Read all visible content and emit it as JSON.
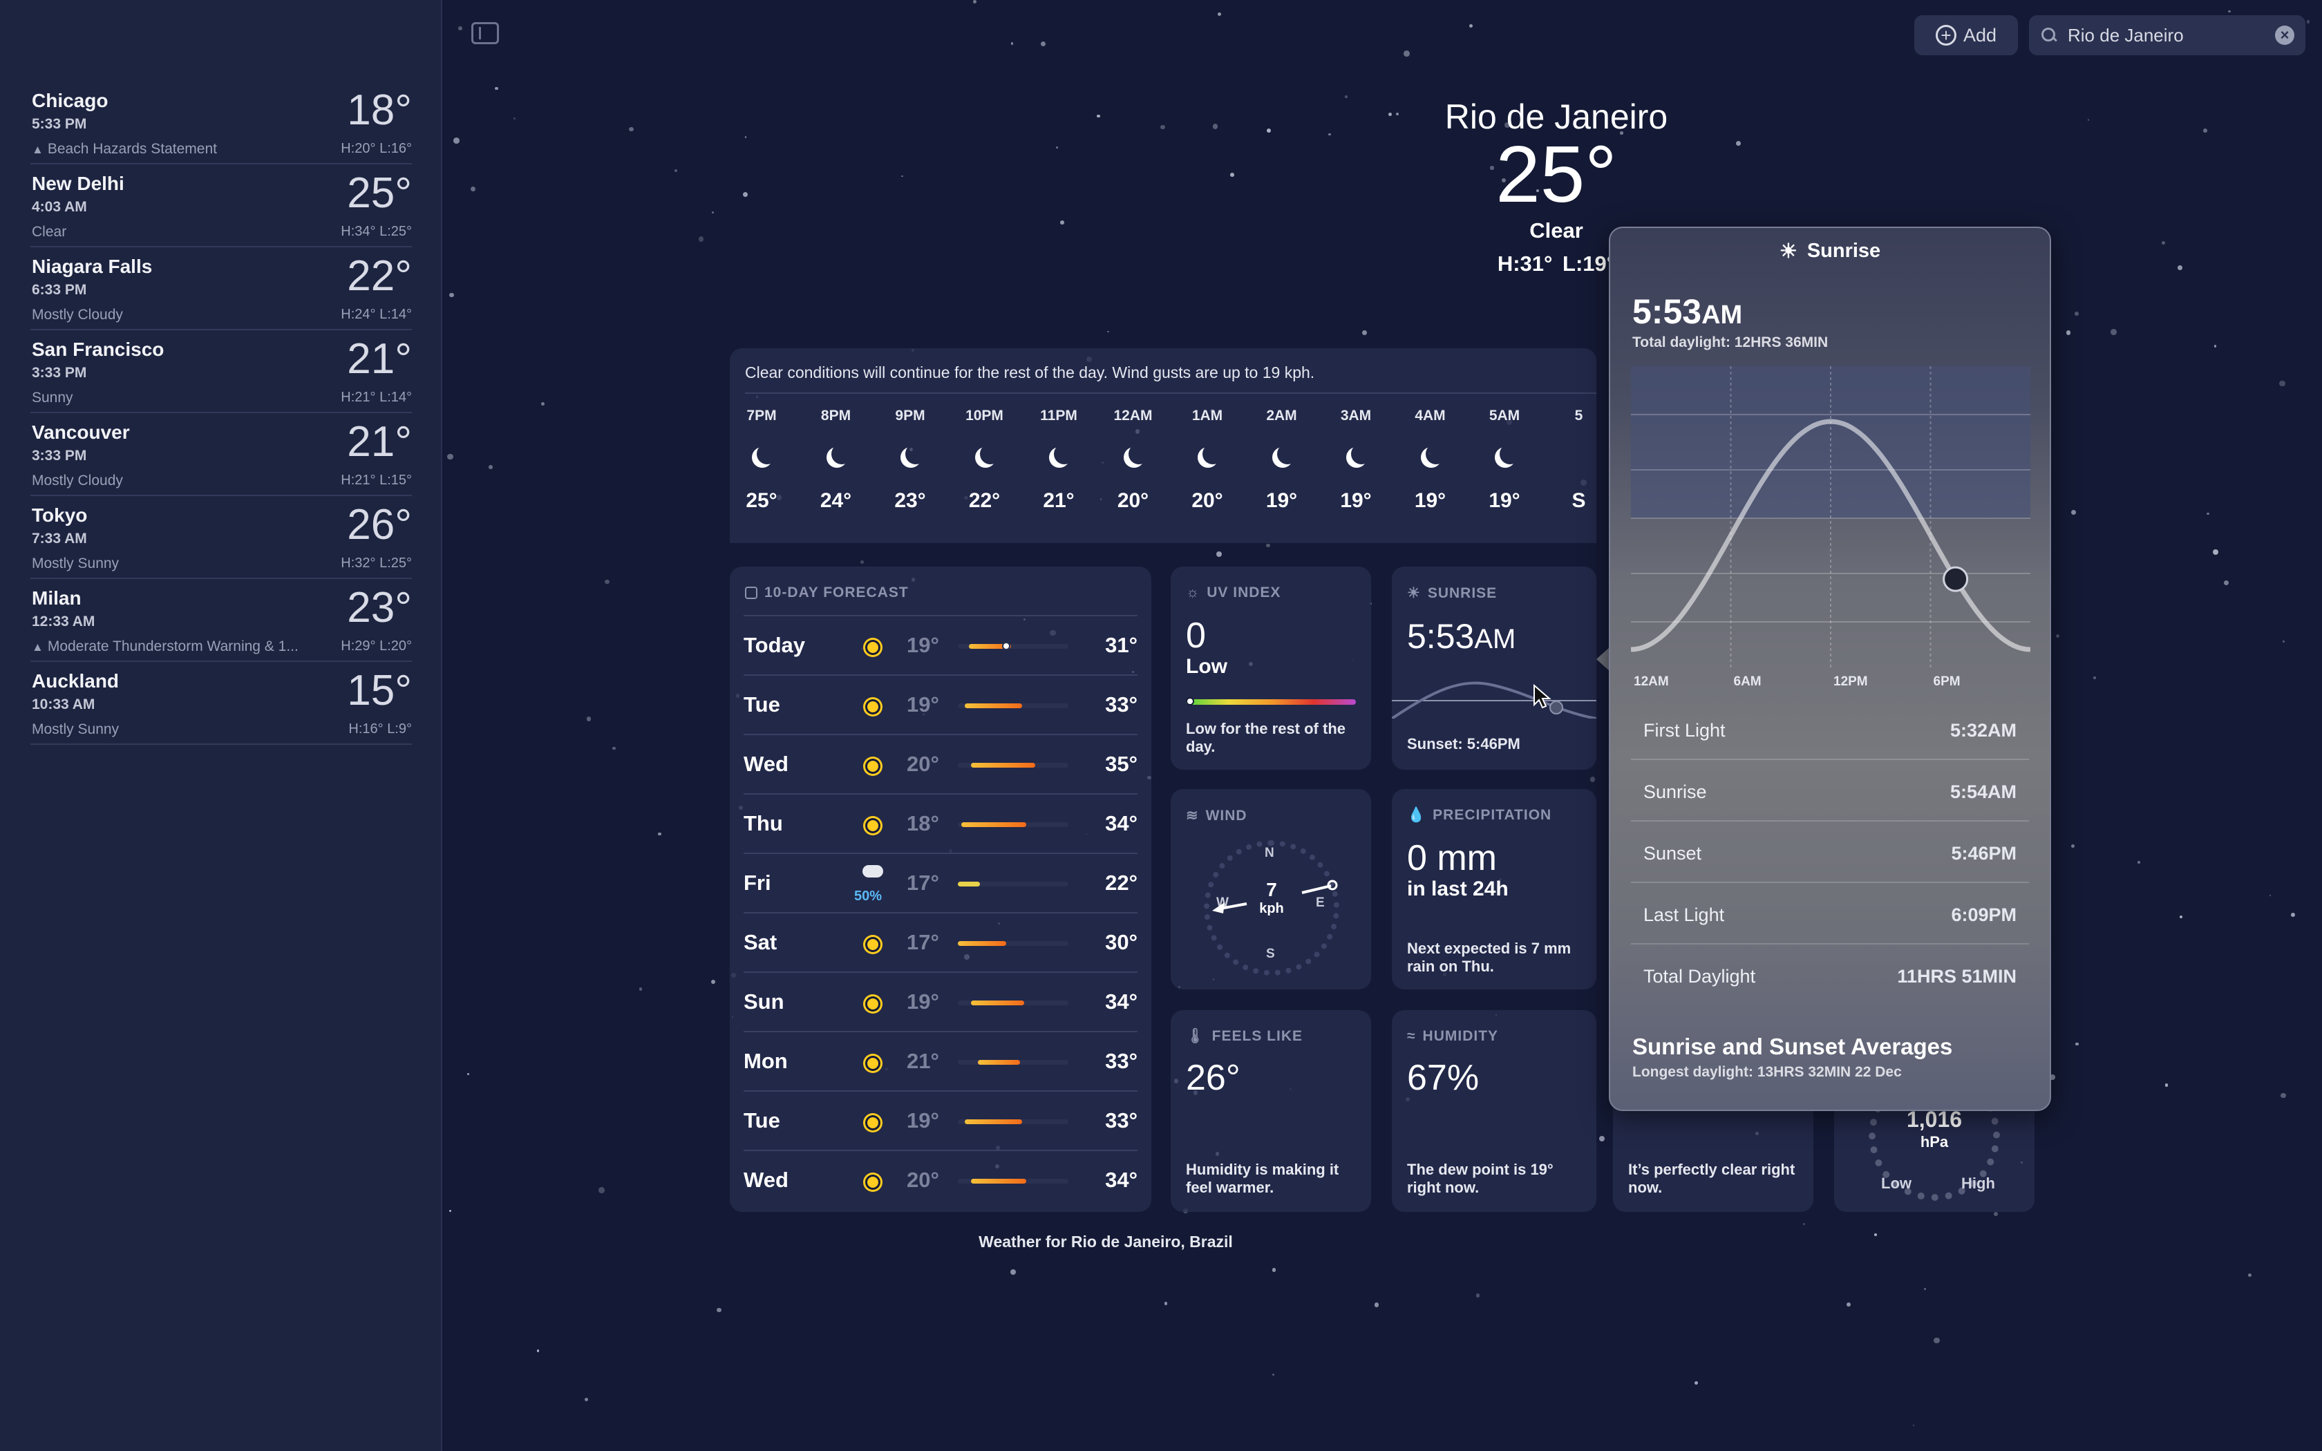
{
  "sidebar": {
    "cities": [
      {
        "name": "Chicago",
        "time": "5:33 PM",
        "condition": "Beach Hazards Statement",
        "warning": true,
        "temp": "18°",
        "hl": "H:20°  L:16°"
      },
      {
        "name": "New Delhi",
        "time": "4:03 AM",
        "condition": "Clear",
        "warning": false,
        "temp": "25°",
        "hl": "H:34°  L:25°"
      },
      {
        "name": "Niagara Falls",
        "time": "6:33 PM",
        "condition": "Mostly Cloudy",
        "warning": false,
        "temp": "22°",
        "hl": "H:24°  L:14°"
      },
      {
        "name": "San Francisco",
        "time": "3:33 PM",
        "condition": "Sunny",
        "warning": false,
        "temp": "21°",
        "hl": "H:21°  L:14°"
      },
      {
        "name": "Vancouver",
        "time": "3:33 PM",
        "condition": "Mostly Cloudy",
        "warning": false,
        "temp": "21°",
        "hl": "H:21°  L:15°"
      },
      {
        "name": "Tokyo",
        "time": "7:33 AM",
        "condition": "Mostly Sunny",
        "warning": false,
        "temp": "26°",
        "hl": "H:32°  L:25°"
      },
      {
        "name": "Milan",
        "time": "12:33 AM",
        "condition": "Moderate Thunderstorm Warning & 1...",
        "warning": true,
        "temp": "23°",
        "hl": "H:29°  L:20°"
      },
      {
        "name": "Auckland",
        "time": "10:33 AM",
        "condition": "Mostly Sunny",
        "warning": false,
        "temp": "15°",
        "hl": "H:16°  L:9°"
      }
    ]
  },
  "toolbar": {
    "add_label": "Add",
    "search_value": "Rio de Janeiro"
  },
  "hero": {
    "city": "Rio de Janeiro",
    "temp": "25°",
    "condition": "Clear",
    "hl": "H:31°  L:19°"
  },
  "hourly": {
    "summary": "Clear conditions will continue for the rest of the day. Wind gusts are up to 19 kph.",
    "hours": [
      {
        "label": "7PM",
        "temp": "25°"
      },
      {
        "label": "8PM",
        "temp": "24°"
      },
      {
        "label": "9PM",
        "temp": "23°"
      },
      {
        "label": "10PM",
        "temp": "22°"
      },
      {
        "label": "11PM",
        "temp": "21°"
      },
      {
        "label": "12AM",
        "temp": "20°"
      },
      {
        "label": "1AM",
        "temp": "20°"
      },
      {
        "label": "2AM",
        "temp": "19°"
      },
      {
        "label": "3AM",
        "temp": "19°"
      },
      {
        "label": "4AM",
        "temp": "19°"
      },
      {
        "label": "5AM",
        "temp": "19°"
      },
      {
        "label": "5",
        "temp": "S"
      }
    ]
  },
  "tenday": {
    "title": "10-DAY FORECAST",
    "days": [
      {
        "name": "Today",
        "low": "19°",
        "high": "31°",
        "icon": "sun-icon",
        "bar_start": 0.1,
        "bar_end": 0.48,
        "current": 0.4
      },
      {
        "name": "Tue",
        "low": "19°",
        "high": "33°",
        "icon": "sun-icon",
        "bar_start": 0.06,
        "bar_end": 0.58
      },
      {
        "name": "Wed",
        "low": "20°",
        "high": "35°",
        "icon": "sun-icon",
        "bar_start": 0.12,
        "bar_end": 0.7
      },
      {
        "name": "Thu",
        "low": "18°",
        "high": "34°",
        "icon": "sun-icon",
        "bar_start": 0.03,
        "bar_end": 0.62
      },
      {
        "name": "Fri",
        "low": "17°",
        "high": "22°",
        "icon": "rain-cloud-icon",
        "rain": "50%",
        "bar_start": 0.0,
        "bar_end": 0.2
      },
      {
        "name": "Sat",
        "low": "17°",
        "high": "30°",
        "icon": "sun-icon",
        "bar_start": 0.0,
        "bar_end": 0.44
      },
      {
        "name": "Sun",
        "low": "19°",
        "high": "34°",
        "icon": "sun-icon",
        "bar_start": 0.12,
        "bar_end": 0.6
      },
      {
        "name": "Mon",
        "low": "21°",
        "high": "33°",
        "icon": "sun-icon",
        "bar_start": 0.18,
        "bar_end": 0.56
      },
      {
        "name": "Tue",
        "low": "19°",
        "high": "33°",
        "icon": "sun-icon",
        "bar_start": 0.06,
        "bar_end": 0.58
      },
      {
        "name": "Wed",
        "low": "20°",
        "high": "34°",
        "icon": "sun-icon",
        "bar_start": 0.12,
        "bar_end": 0.62
      }
    ]
  },
  "uv": {
    "title": "UV INDEX",
    "value": "0",
    "level": "Low",
    "desc": "Low for the rest of the day."
  },
  "sunrise_card": {
    "title": "SUNRISE",
    "time": "5:53",
    "ampm": "AM",
    "sunset": "Sunset: 5:46PM"
  },
  "wind": {
    "title": "WIND",
    "value": "7",
    "unit": "kph",
    "n": "N",
    "s": "S",
    "e": "E",
    "w": "W"
  },
  "precip": {
    "title": "PRECIPITATION",
    "value": "0 mm",
    "sub": "in last 24h",
    "desc": "Next expected is 7 mm rain on Thu."
  },
  "feels": {
    "title": "FEELS LIKE",
    "value": "26°",
    "desc": "Humidity is making it feel warmer."
  },
  "humidity": {
    "title": "HUMIDITY",
    "value": "67%",
    "desc": "The dew point is 19° right now."
  },
  "visibility": {
    "desc": "It’s perfectly clear right now."
  },
  "pressure": {
    "value": "1,016",
    "unit": "hPa",
    "low": "Low",
    "high": "High"
  },
  "footer": "Weather for Rio de Janeiro, Brazil",
  "popover": {
    "title": "Sunrise",
    "time": "5:53",
    "ampm": "AM",
    "total": "Total daylight: 12HRS 36MIN",
    "x_labels": [
      "12AM",
      "6AM",
      "12PM",
      "6PM"
    ],
    "rows": [
      {
        "label": "First Light",
        "value": "5:32AM"
      },
      {
        "label": "Sunrise",
        "value": "5:54AM"
      },
      {
        "label": "Sunset",
        "value": "5:46PM"
      },
      {
        "label": "Last Light",
        "value": "6:09PM"
      },
      {
        "label": "Total Daylight",
        "value": "11HRS 51MIN"
      }
    ],
    "avg_title": "Sunrise and Sunset Averages",
    "avg_sub": "Longest daylight: 13HRS 32MIN 22 Dec",
    "current_hour": 19.5
  }
}
